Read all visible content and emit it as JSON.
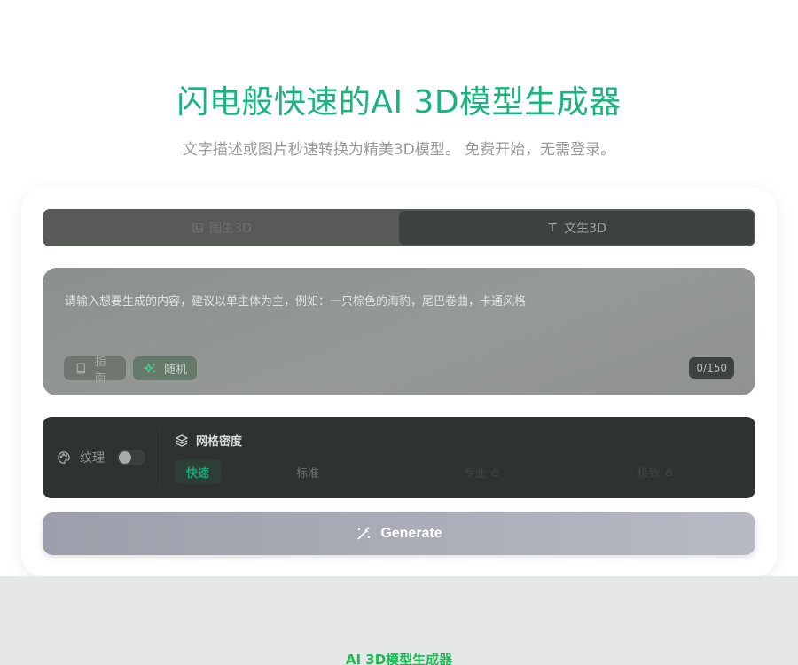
{
  "hero": {
    "title": "闪电般快速的AI 3D模型生成器",
    "subtitle": "文字描述或图片秒速转换为精美3D模型。 免费开始，无需登录。"
  },
  "tabs": [
    {
      "label": "图生3D",
      "icon": "image-icon",
      "active": false
    },
    {
      "label": "文生3D",
      "icon": "text-icon",
      "active": true
    }
  ],
  "prompt": {
    "placeholder": "请输入想要生成的内容，建议以单主体为主，例如：一只棕色的海豹，尾巴卷曲，卡通风格",
    "guide_label": "指南",
    "random_label": "随机",
    "counter": "0/150"
  },
  "settings": {
    "texture_label": "纹理",
    "texture_enabled": false,
    "density_label": "网格密度",
    "options": [
      {
        "label": "快速",
        "active": true,
        "locked": false
      },
      {
        "label": "标准",
        "active": false,
        "locked": false
      },
      {
        "label": "专业",
        "active": false,
        "locked": true
      },
      {
        "label": "极致",
        "active": false,
        "locked": true
      }
    ]
  },
  "generate_label": "Generate",
  "footer": {
    "section_title": "AI 3D模型生成器"
  },
  "colors": {
    "accent": "#19b37e",
    "generate_start": "#9c9fab",
    "generate_end": "#b7bac3"
  }
}
